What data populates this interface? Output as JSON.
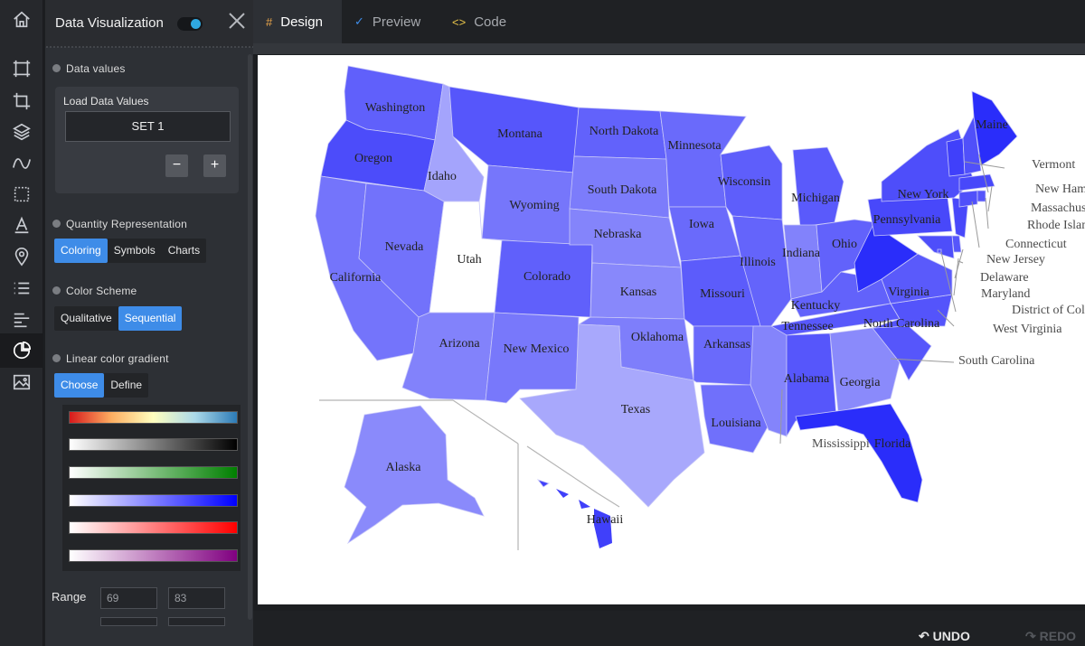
{
  "panel": {
    "title": "Data Visualization",
    "sections": {
      "data_values": "Data values",
      "load_title": "Load Data Values",
      "set_button": "SET 1",
      "minus": "−",
      "plus": "+",
      "quantity": "Quantity Representation",
      "quantity_options": [
        "Coloring",
        "Symbols",
        "Charts"
      ],
      "color_scheme": "Color Scheme",
      "scheme_options": [
        "Qualitative",
        "Sequential"
      ],
      "gradient": "Linear color gradient",
      "gradient_options": [
        "Choose",
        "Define"
      ],
      "range_label": "Range",
      "range_min": "69",
      "range_max": "83"
    }
  },
  "tabs": [
    "Design",
    "Preview",
    "Code"
  ],
  "bottom": {
    "undo": "UNDO",
    "redo": "REDO"
  },
  "colors": {
    "accent": "#3e8ce8",
    "map_dark": "#2a2dfa",
    "map_mid": "#6868fb",
    "map_light": "#a6a6fc"
  },
  "map": {
    "states": [
      {
        "name": "Washington",
        "shade": "#6060fb"
      },
      {
        "name": "Oregon",
        "shade": "#4c4cfa"
      },
      {
        "name": "California",
        "shade": "#7474fb"
      },
      {
        "name": "Nevada",
        "shade": "#7272fb"
      },
      {
        "name": "Idaho",
        "shade": "#a4a4fc"
      },
      {
        "name": "Montana",
        "shade": "#5656fb"
      },
      {
        "name": "Wyoming",
        "shade": "#7676fb"
      },
      {
        "name": "Utah",
        "shade": "#ffffff"
      },
      {
        "name": "Colorado",
        "shade": "#6060fb"
      },
      {
        "name": "Arizona",
        "shade": "#8282fb"
      },
      {
        "name": "New Mexico",
        "shade": "#7878fb"
      },
      {
        "name": "North Dakota",
        "shade": "#6262fb"
      },
      {
        "name": "South Dakota",
        "shade": "#7c7cfb"
      },
      {
        "name": "Nebraska",
        "shade": "#8484fb"
      },
      {
        "name": "Kansas",
        "shade": "#8888fb"
      },
      {
        "name": "Oklahoma",
        "shade": "#7e7efb"
      },
      {
        "name": "Texas",
        "shade": "#a8a8fc"
      },
      {
        "name": "Minnesota",
        "shade": "#6a6afb"
      },
      {
        "name": "Iowa",
        "shade": "#6a6afb"
      },
      {
        "name": "Missouri",
        "shade": "#5c5cfb"
      },
      {
        "name": "Arkansas",
        "shade": "#6a6afb"
      },
      {
        "name": "Louisiana",
        "shade": "#7070fb"
      },
      {
        "name": "Wisconsin",
        "shade": "#5e5efb"
      },
      {
        "name": "Illinois",
        "shade": "#6464fb"
      },
      {
        "name": "Mississippi",
        "shade": "#8484fb"
      },
      {
        "name": "Michigan",
        "shade": "#5a5afb"
      },
      {
        "name": "Indiana",
        "shade": "#8282fb"
      },
      {
        "name": "Kentucky",
        "shade": "#6262fb"
      },
      {
        "name": "Tennessee",
        "shade": "#5858fb"
      },
      {
        "name": "Alabama",
        "shade": "#5656fb"
      },
      {
        "name": "Ohio",
        "shade": "#6262fb"
      },
      {
        "name": "Georgia",
        "shade": "#8a8afb"
      },
      {
        "name": "Florida",
        "shade": "#2a2dfa"
      },
      {
        "name": "South Carolina",
        "shade": "#5656fb"
      },
      {
        "name": "North Carolina",
        "shade": "#5454fb"
      },
      {
        "name": "Virginia",
        "shade": "#5a5afb"
      },
      {
        "name": "West Virginia",
        "shade": "#2a2dfa"
      },
      {
        "name": "Pennsylvania",
        "shade": "#4848fa"
      },
      {
        "name": "New York",
        "shade": "#4e4efa"
      },
      {
        "name": "New Jersey",
        "shade": "#4848fa"
      },
      {
        "name": "Delaware",
        "shade": "#5656fb"
      },
      {
        "name": "Maryland",
        "shade": "#4e4efa"
      },
      {
        "name": "District of Columbia",
        "shade": "#5656fb"
      },
      {
        "name": "Connecticut",
        "shade": "#5050fa"
      },
      {
        "name": "Rhode Island",
        "shade": "#5656fb"
      },
      {
        "name": "Massachusetts",
        "shade": "#4848fa"
      },
      {
        "name": "Vermont",
        "shade": "#4040fa"
      },
      {
        "name": "New Hampshire",
        "shade": "#5050fa"
      },
      {
        "name": "Maine",
        "shade": "#2a2dfa"
      },
      {
        "name": "Alaska",
        "shade": "#8a8afb"
      },
      {
        "name": "Hawaii",
        "shade": "#4040fa"
      }
    ]
  }
}
